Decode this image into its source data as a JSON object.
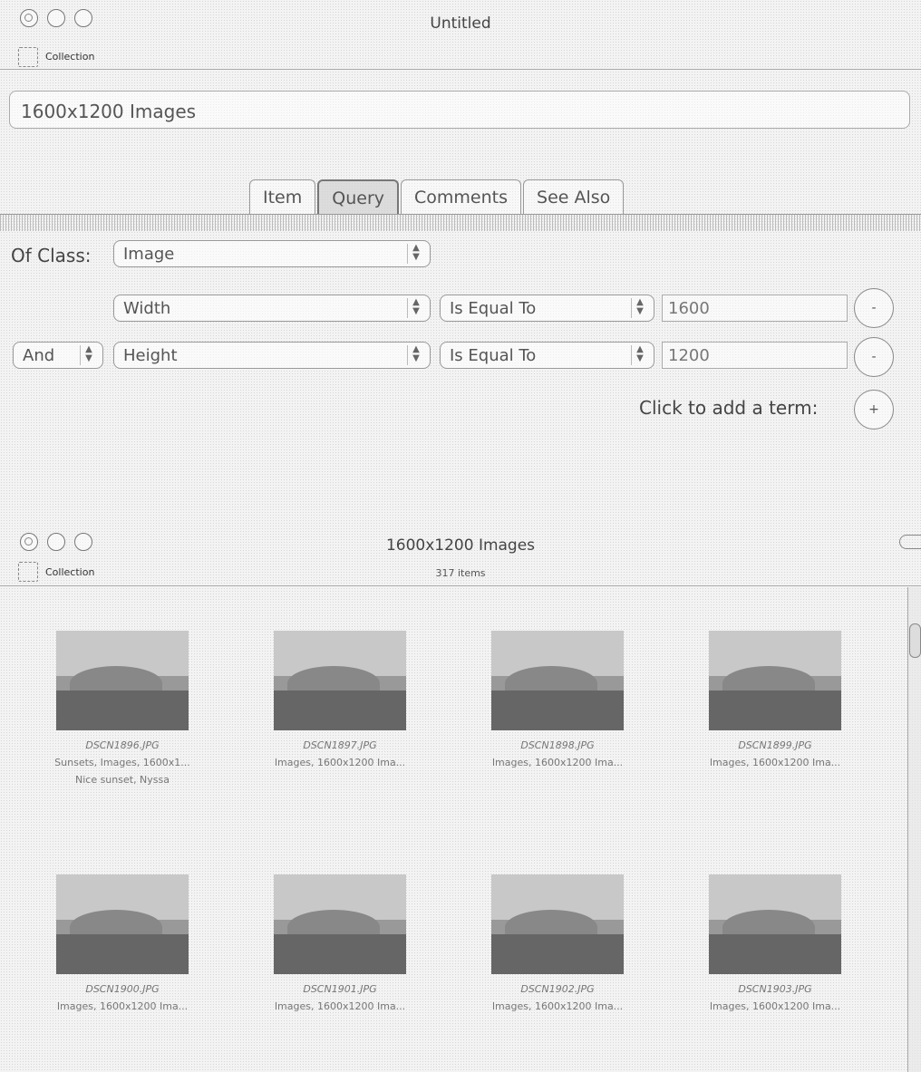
{
  "window1": {
    "title": "Untitled",
    "collection_label": "Collection",
    "name_value": "1600x1200 Images",
    "tabs": [
      "Item",
      "Query",
      "Comments",
      "See Also"
    ],
    "active_tab": "Query",
    "query": {
      "of_class_label": "Of Class:",
      "class_value": "Image",
      "rows": [
        {
          "connector": "",
          "field": "Width",
          "operator": "Is Equal To",
          "value": "1600"
        },
        {
          "connector": "And",
          "field": "Height",
          "operator": "Is Equal To",
          "value": "1200"
        }
      ],
      "add_term_label": "Click to add a term:",
      "remove_symbol": "-",
      "add_symbol": "+"
    }
  },
  "window2": {
    "title": "1600x1200 Images",
    "collection_label": "Collection",
    "item_count": "317 items",
    "items": [
      {
        "filename": "DSCN1896.JPG",
        "subtitle": "Sunsets, Images, 1600x1...",
        "extra": "Nice sunset, Nyssa"
      },
      {
        "filename": "DSCN1897.JPG",
        "subtitle": "Images, 1600x1200 Ima...",
        "extra": ""
      },
      {
        "filename": "DSCN1898.JPG",
        "subtitle": "Images, 1600x1200 Ima...",
        "extra": ""
      },
      {
        "filename": "DSCN1899.JPG",
        "subtitle": "Images, 1600x1200 Ima...",
        "extra": ""
      },
      {
        "filename": "DSCN1900.JPG",
        "subtitle": "Images, 1600x1200 Ima...",
        "extra": ""
      },
      {
        "filename": "DSCN1901.JPG",
        "subtitle": "Images, 1600x1200 Ima...",
        "extra": ""
      },
      {
        "filename": "DSCN1902.JPG",
        "subtitle": "Images, 1600x1200 Ima...",
        "extra": ""
      },
      {
        "filename": "DSCN1903.JPG",
        "subtitle": "Images, 1600x1200 Ima...",
        "extra": ""
      }
    ]
  }
}
